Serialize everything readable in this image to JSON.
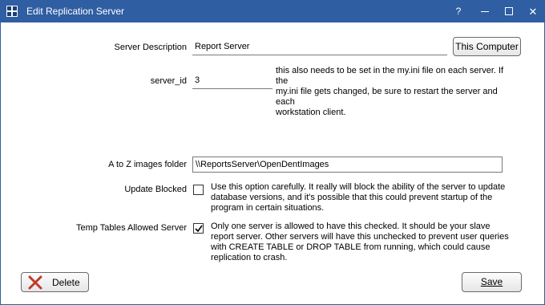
{
  "window": {
    "title": "Edit Replication Server",
    "help_label": "?",
    "close_label": "✕"
  },
  "form": {
    "server_description": {
      "label": "Server Description",
      "value": "Report Server"
    },
    "this_computer_label": "This Computer",
    "server_id": {
      "label": "server_id",
      "value": "3",
      "note_lines": [
        "this also needs to be set in the my.ini file on each server.  If the",
        "my.ini file gets changed, be sure to restart the server and each",
        "workstation client."
      ]
    },
    "atoz_folder": {
      "label": "A to Z images folder",
      "value": "\\\\ReportsServer\\OpenDentImages"
    },
    "update_blocked": {
      "label": "Update Blocked",
      "checked": false,
      "note_lines": [
        "Use this option carefully.  It really will block the ability of the server to update",
        "database versions, and it's possible that this could prevent startup of the",
        "program in certain situations."
      ]
    },
    "temp_tables": {
      "label": "Temp Tables Allowed Server",
      "checked": true,
      "note_lines": [
        "Only one server is allowed to have this checked.  It should be your slave",
        "report server.  Other servers will have this unchecked to prevent user queries",
        "with CREATE TABLE or DROP TABLE from running, which could cause",
        "replication to crash."
      ]
    }
  },
  "footer": {
    "delete_label": "Delete",
    "save_label": "Save"
  }
}
